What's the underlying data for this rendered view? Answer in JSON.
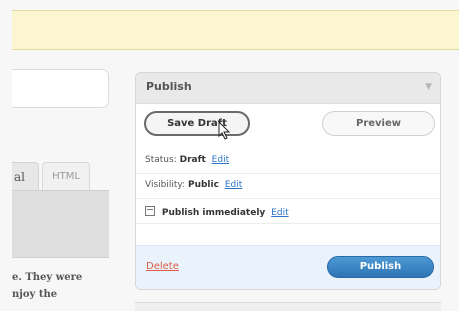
{
  "editor": {
    "tabs": {
      "visual_partial": "al",
      "html": "HTML"
    },
    "content_lines": [
      "e. They were",
      "njoy the"
    ]
  },
  "publish": {
    "title": "Publish",
    "toggle_icon": "chevron-down-icon",
    "save_draft": "Save Draft",
    "preview": "Preview",
    "status_label": "Status:",
    "status_value": "Draft",
    "status_edit": "Edit",
    "visibility_label": "Visibility:",
    "visibility_value": "Public",
    "visibility_edit": "Edit",
    "publish_time_text": "Publish immediately",
    "publish_time_edit": "Edit",
    "delete": "Delete",
    "publish_button": "Publish"
  },
  "colors": {
    "notice_background": "#fbf6cf",
    "link": "#2b74c8",
    "delete": "#dd5a48",
    "publish_button": "#2e74b4"
  }
}
